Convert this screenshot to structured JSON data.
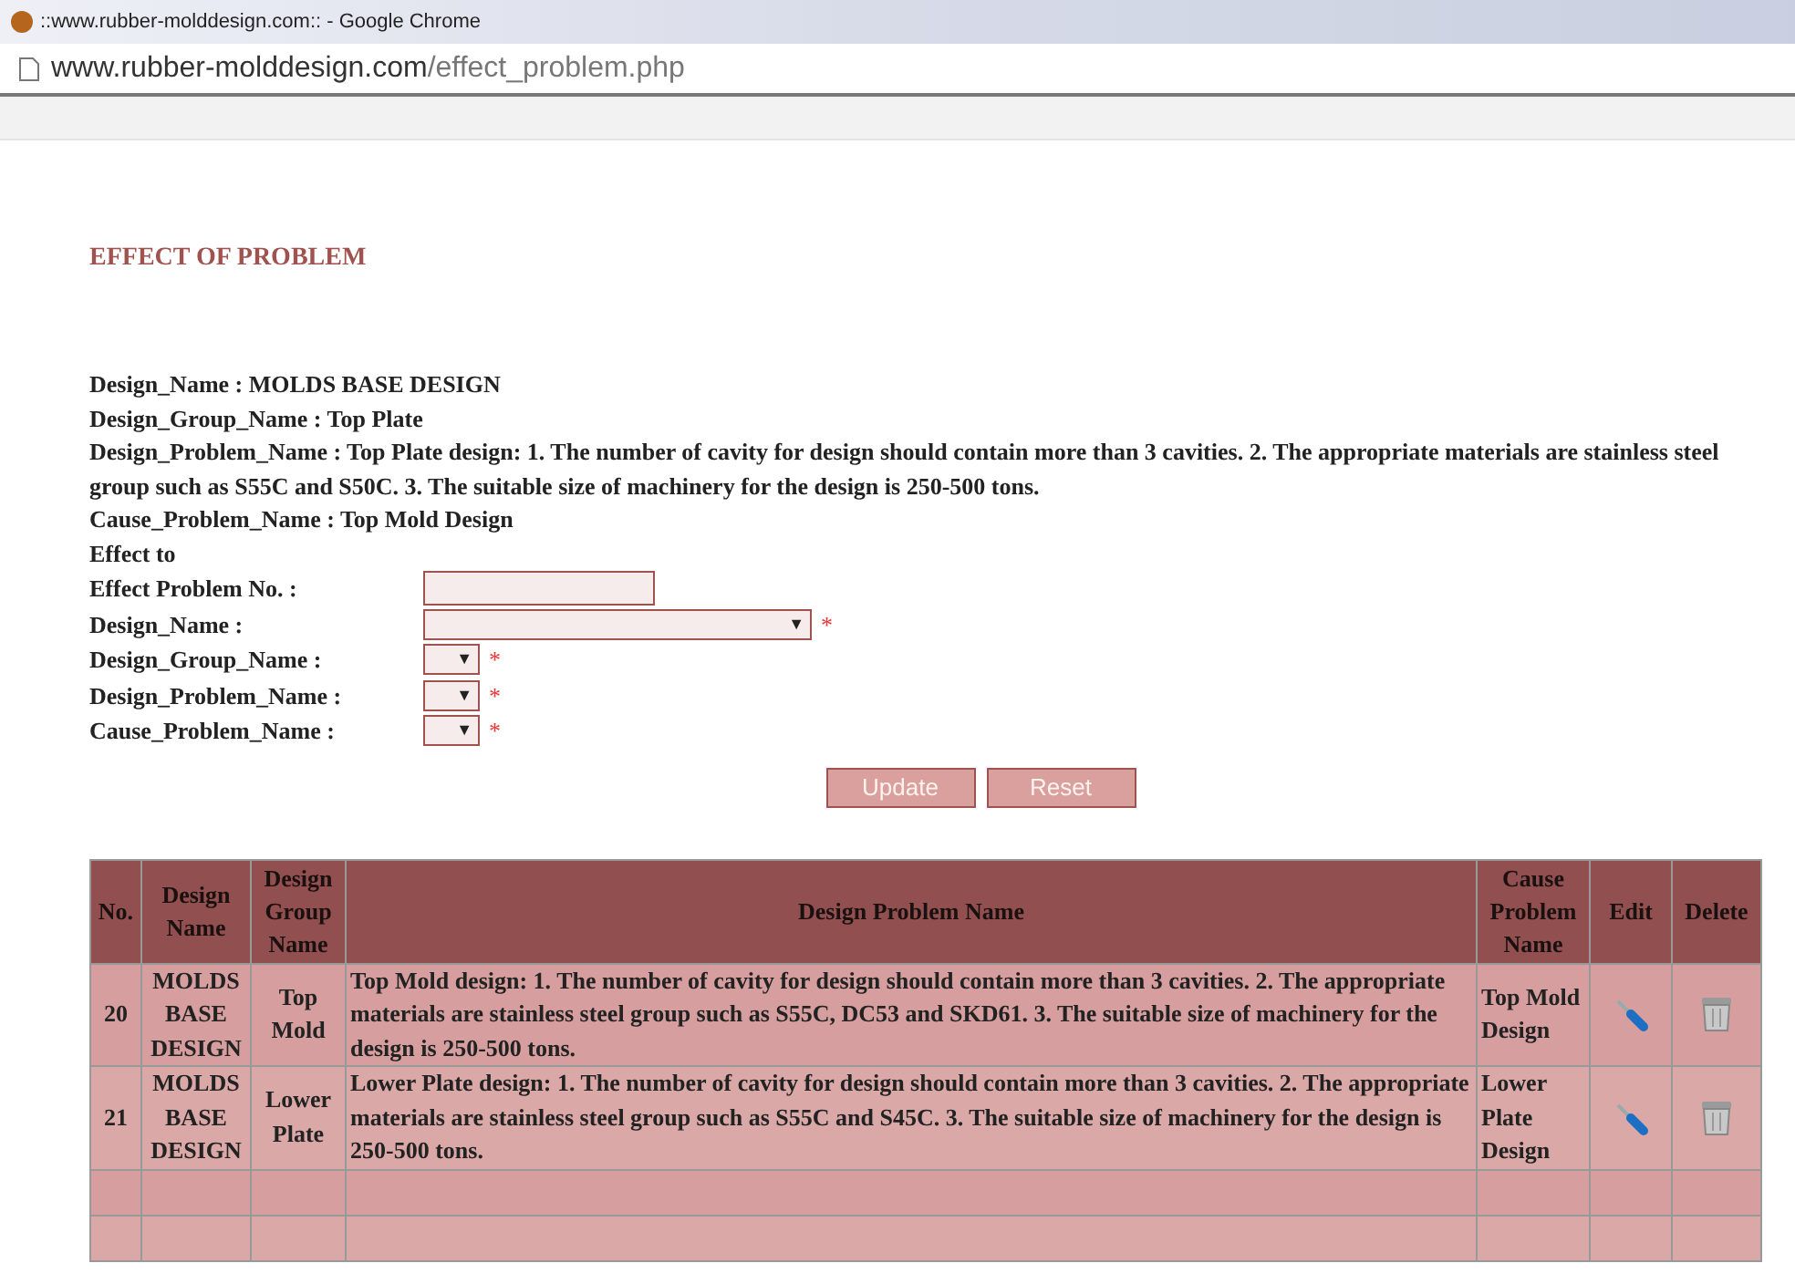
{
  "window": {
    "title": "::www.rubber-molddesign.com:: - Google Chrome"
  },
  "address_bar": {
    "domain": "www.rubber-molddesign.com",
    "path": "/effect_problem.php"
  },
  "heading": "EFFECT OF PROBLEM",
  "info_lines": [
    "Design_Name : MOLDS BASE DESIGN",
    "Design_Group_Name : Top Plate",
    "Design_Problem_Name : Top Plate design: 1. The number of cavity for design should contain more than 3 cavities. 2. The appropriate materials are stainless steel group such as S55C and S50C. 3. The suitable size of machinery for the design is 250-500 tons.",
    "Cause_Problem_Name : Top Mold Design",
    "Effect to"
  ],
  "form_fields": [
    {
      "label": "Effect Problem No. :",
      "kind": "text",
      "required": false
    },
    {
      "label": "Design_Name :",
      "kind": "select-wide",
      "required": true
    },
    {
      "label": "Design_Group_Name :",
      "kind": "select",
      "required": true
    },
    {
      "label": "Design_Problem_Name :",
      "kind": "select",
      "required": true
    },
    {
      "label": "Cause_Problem_Name :",
      "kind": "select",
      "required": true
    }
  ],
  "required_mark": "*",
  "dropdown_caret": "▼",
  "buttons": [
    "Update",
    "Reset"
  ],
  "table": {
    "columns": [
      "No.",
      "Design Name",
      "Design Group Name",
      "Design Problem Name",
      "Cause Problem Name",
      "Edit",
      "Delete"
    ],
    "rows": [
      {
        "kind": "data",
        "no": "20",
        "design_name": "MOLDS BASE DESIGN",
        "group": "Top Mold",
        "problem": "Top Mold design: 1. The number of cavity for design should contain more than 3 cavities. 2. The appropriate materials are stainless steel group such as S55C, DC53 and SKD61. 3. The suitable size of machinery for the design is 250-500 tons.",
        "cause": "Top Mold Design"
      },
      {
        "kind": "data",
        "no": "21",
        "design_name": "MOLDS BASE DESIGN",
        "group": "Lower Plate",
        "problem": "Lower Plate design: 1. The number of cavity for design should contain more than 3 cavities. 2. The appropriate materials are stainless steel group such as S55C and S45C. 3. The suitable size of machinery for the design is 250-500 tons.",
        "cause": "Lower Plate Design"
      },
      {
        "kind": "empty"
      },
      {
        "kind": "empty"
      }
    ]
  }
}
